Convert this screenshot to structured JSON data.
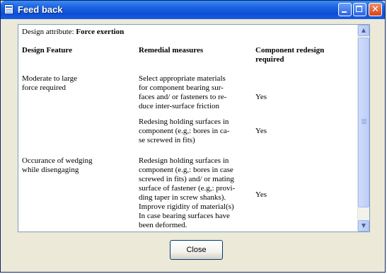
{
  "window": {
    "title": "Feed back"
  },
  "attribute": {
    "label": "Design attribute:",
    "value": "Force exertion"
  },
  "table": {
    "headers": {
      "feature": "Design Feature",
      "measures": "Remedial measures",
      "redesign": "Component redesign\nrequired"
    },
    "rows": [
      {
        "feature": "Moderate to large\nforce required",
        "measures": "Select appropriate materials\nfor component bearing sur-\nfaces and/ or fasteners to re-\nduce inter-surface friction",
        "redesign": "Yes"
      },
      {
        "feature": "",
        "measures": "Redesing holding  surfaces in\ncomponent (e.g,: bores in ca-\nse screwed in fits)",
        "redesign": "Yes"
      },
      {
        "feature": "Occurance of wedging\nwhile disengaging",
        "measures": "Redesign holding surfaces in\ncomponent (e.g,: bores in case\nscrewed in fits) and/ or mating\nsurface of fastener (e.g,: provi-\nding taper in screw shanks).\nImprove rigidity of material(s)\nIn case bearing surfaces have\nbeen deformed.\nProvide appropriate tolerances",
        "redesign": "Yes"
      }
    ]
  },
  "buttons": {
    "close": "Close"
  },
  "icons": {
    "app": "document-icon",
    "minimize": "minimize-icon",
    "maximize": "maximize-icon",
    "close": "close-icon",
    "scroll_up": "chevron-up-icon",
    "scroll_down": "chevron-down-icon"
  },
  "colors": {
    "titlebar": "#0b4fd6",
    "close_button": "#d6441b",
    "window_bg": "#ece9d8"
  }
}
